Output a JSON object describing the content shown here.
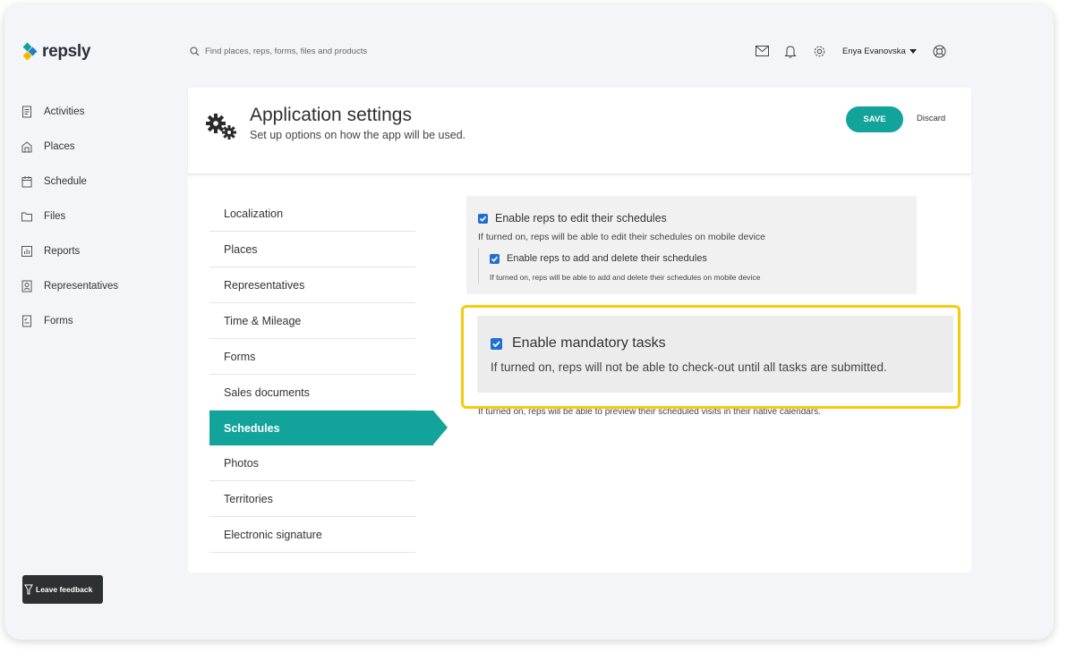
{
  "app": {
    "logo_text": "repsly"
  },
  "search": {
    "placeholder": "Find places, reps, forms, files and products"
  },
  "topbar": {
    "user_name": "Enya Evanovska"
  },
  "sidebar": {
    "items": [
      {
        "label": "Activities",
        "icon": "activities-icon"
      },
      {
        "label": "Places",
        "icon": "places-icon"
      },
      {
        "label": "Schedule",
        "icon": "schedule-icon"
      },
      {
        "label": "Files",
        "icon": "files-icon"
      },
      {
        "label": "Reports",
        "icon": "reports-icon"
      },
      {
        "label": "Representatives",
        "icon": "representatives-icon"
      },
      {
        "label": "Forms",
        "icon": "forms-icon"
      }
    ]
  },
  "header": {
    "title": "Application settings",
    "subtitle": "Set up options on how the app will be used.",
    "save_label": "SAVE",
    "discard_label": "Discard"
  },
  "settings_nav": {
    "items": [
      "Localization",
      "Places",
      "Representatives",
      "Time & Mileage",
      "Forms",
      "Sales documents",
      "Schedules",
      "Photos",
      "Territories",
      "Electronic signature"
    ],
    "active": "Schedules"
  },
  "settings": {
    "edit_schedules": {
      "label": "Enable reps to edit their schedules",
      "desc": "If turned on, reps will be able to edit their schedules on mobile device",
      "checked": true
    },
    "add_delete_schedules": {
      "label": "Enable reps to add and delete their schedules",
      "desc": "If turned on, reps will be able to add and delete their schedules on mobile device",
      "checked": true
    },
    "mandatory_tasks": {
      "label": "Enable mandatory tasks",
      "desc": "If turned on, reps will not be able to check-out until all tasks are submitted.",
      "checked": true
    },
    "calendar_preview_desc": "If turned on, reps will be able to preview their scheduled visits in their native calendars."
  },
  "feedback": {
    "label": "Leave feedback"
  },
  "colors": {
    "accent": "#12a39a",
    "highlight": "#f5cc0b",
    "checkbox": "#1f6fd0"
  }
}
